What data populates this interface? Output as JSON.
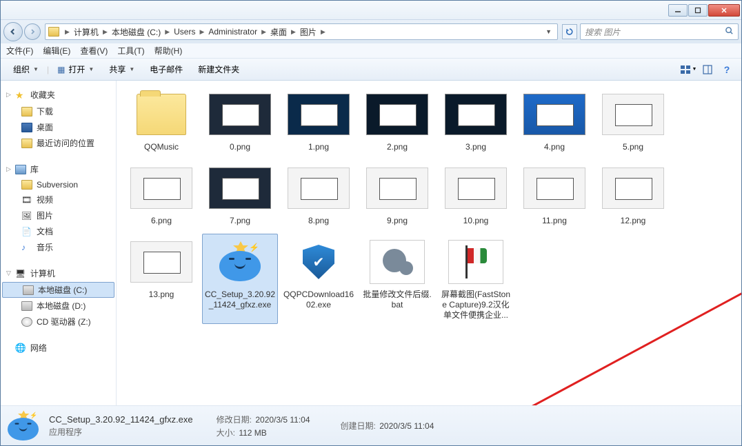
{
  "breadcrumb": [
    "计算机",
    "本地磁盘 (C:)",
    "Users",
    "Administrator",
    "桌面",
    "图片"
  ],
  "search_placeholder": "搜索 图片",
  "menu": {
    "file": "文件(F)",
    "edit": "编辑(E)",
    "view": "查看(V)",
    "tools": "工具(T)",
    "help": "帮助(H)"
  },
  "toolbar": {
    "organize": "组织",
    "open": "打开",
    "share": "共享",
    "email": "电子邮件",
    "new_folder": "新建文件夹"
  },
  "sidebar": {
    "favorites": {
      "header": "收藏夹",
      "downloads": "下载",
      "desktop": "桌面",
      "recent": "最近访问的位置"
    },
    "libraries": {
      "header": "库",
      "subversion": "Subversion",
      "videos": "视频",
      "pictures": "图片",
      "documents": "文档",
      "music": "音乐"
    },
    "computer": {
      "header": "计算机",
      "drive_c": "本地磁盘 (C:)",
      "drive_d": "本地磁盘 (D:)",
      "drive_cd": "CD 驱动器 (Z:)"
    },
    "network": {
      "header": "网络"
    }
  },
  "items": [
    {
      "name": "QQMusic",
      "type": "folder"
    },
    {
      "name": "0.png",
      "type": "image",
      "bg": "ss-dark"
    },
    {
      "name": "1.png",
      "type": "image",
      "bg": "ss-dark2"
    },
    {
      "name": "2.png",
      "type": "image",
      "bg": "ss-dark3"
    },
    {
      "name": "3.png",
      "type": "image",
      "bg": "ss-dark3"
    },
    {
      "name": "4.png",
      "type": "image",
      "bg": "ss-desk"
    },
    {
      "name": "5.png",
      "type": "image",
      "bg": "ss-white"
    },
    {
      "name": "6.png",
      "type": "image",
      "bg": "ss-white"
    },
    {
      "name": "7.png",
      "type": "image",
      "bg": "ss-dark"
    },
    {
      "name": "8.png",
      "type": "image",
      "bg": "ss-white"
    },
    {
      "name": "9.png",
      "type": "image",
      "bg": "ss-white"
    },
    {
      "name": "10.png",
      "type": "image",
      "bg": "ss-white"
    },
    {
      "name": "11.png",
      "type": "image",
      "bg": "ss-white"
    },
    {
      "name": "12.png",
      "type": "image",
      "bg": "ss-white"
    },
    {
      "name": "13.png",
      "type": "image",
      "bg": "ss-white"
    },
    {
      "name": "CC_Setup_3.20.92_11424_gfxz.exe",
      "type": "cc",
      "selected": true
    },
    {
      "name": "QQPCDownload1602.exe",
      "type": "shield"
    },
    {
      "name": "批量修改文件后缀.bat",
      "type": "gears"
    },
    {
      "name": "屏幕截图(FastStone Capture)9.2汉化单文件便携企业...",
      "type": "flag"
    }
  ],
  "details": {
    "filename": "CC_Setup_3.20.92_11424_gfxz.exe",
    "filetype": "应用程序",
    "modified_label": "修改日期:",
    "modified": "2020/3/5 11:04",
    "size_label": "大小:",
    "size": "112 MB",
    "created_label": "创建日期:",
    "created": "2020/3/5 11:04"
  }
}
